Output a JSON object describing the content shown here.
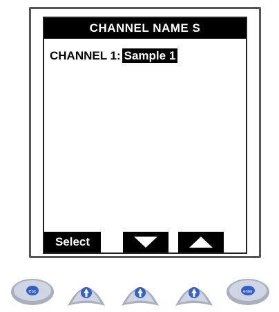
{
  "screen": {
    "title": "CHANNEL NAME S",
    "channel_label": "CHANNEL 1:",
    "channel_value": "Sample 1"
  },
  "softkeys": {
    "select_label": "Select",
    "down_icon": "triangle-down-icon",
    "up_icon": "triangle-up-icon"
  },
  "hardware_buttons": {
    "left_label": "esc",
    "right_label": "enter"
  },
  "colors": {
    "screen_bg": "#ffffff",
    "inverse": "#000000",
    "button_face": "#c8cfdc",
    "button_accent": "#2f5fd0"
  }
}
